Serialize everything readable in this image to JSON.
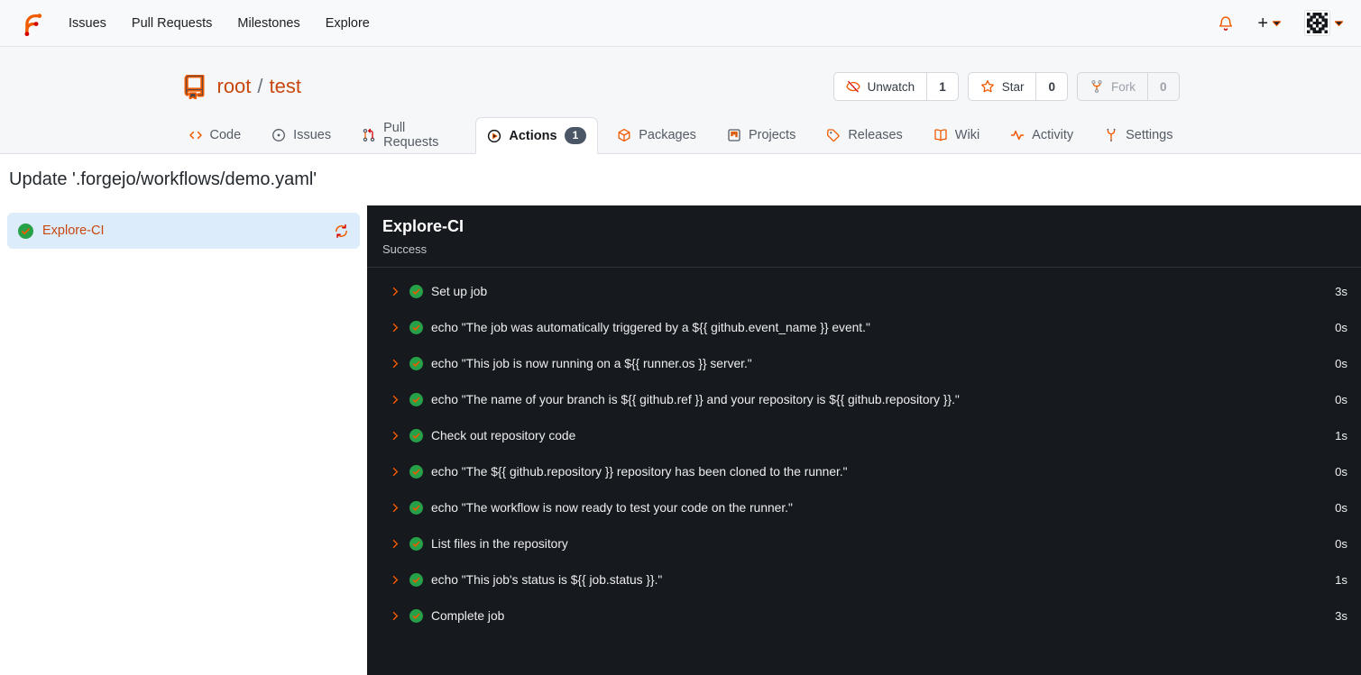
{
  "navbar": {
    "links": [
      {
        "label": "Issues"
      },
      {
        "label": "Pull Requests"
      },
      {
        "label": "Milestones"
      },
      {
        "label": "Explore"
      }
    ],
    "plus_label": "+"
  },
  "repo": {
    "owner": "root",
    "slash": "/",
    "name": "test",
    "buttons": [
      {
        "label": "Unwatch",
        "count": "1",
        "icon": "eye-slash",
        "disabled": false
      },
      {
        "label": "Star",
        "count": "0",
        "icon": "star",
        "disabled": false
      },
      {
        "label": "Fork",
        "count": "0",
        "icon": "fork",
        "disabled": true
      }
    ],
    "tabs": [
      {
        "label": "Code",
        "icon": "code",
        "active": false
      },
      {
        "label": "Issues",
        "icon": "issue-circle",
        "active": false
      },
      {
        "label": "Pull Requests",
        "icon": "git-pull-request",
        "active": false
      },
      {
        "label": "Actions",
        "icon": "play-circle",
        "active": true,
        "badge": "1"
      },
      {
        "label": "Packages",
        "icon": "package-cube",
        "active": false
      },
      {
        "label": "Projects",
        "icon": "project-board",
        "active": false
      },
      {
        "label": "Releases",
        "icon": "tag",
        "active": false
      },
      {
        "label": "Wiki",
        "icon": "book-open",
        "active": false
      },
      {
        "label": "Activity",
        "icon": "pulse",
        "active": false
      }
    ],
    "settings_tab": {
      "label": "Settings"
    }
  },
  "run": {
    "commit_title": "Update '.forgejo/workflows/demo.yaml'",
    "sidebar_job": {
      "name": "Explore-CI"
    },
    "panel": {
      "title": "Explore-CI",
      "status": "Success"
    },
    "steps": [
      {
        "name": "Set up job",
        "duration": "3s"
      },
      {
        "name": "echo \"The job was automatically triggered by a ${{ github.event_name }} event.\"",
        "duration": "0s"
      },
      {
        "name": "echo \"This job is now running on a ${{ runner.os }} server.\"",
        "duration": "0s"
      },
      {
        "name": "echo \"The name of your branch is ${{ github.ref }} and your repository is ${{ github.repository }}.\"",
        "duration": "0s"
      },
      {
        "name": "Check out repository code",
        "duration": "1s"
      },
      {
        "name": "echo \"The ${{ github.repository }} repository has been cloned to the runner.\"",
        "duration": "0s"
      },
      {
        "name": "echo \"The workflow is now ready to test your code on the runner.\"",
        "duration": "0s"
      },
      {
        "name": "List files in the repository",
        "duration": "0s"
      },
      {
        "name": "echo \"This job's status is ${{ job.status }}.\"",
        "duration": "1s"
      },
      {
        "name": "Complete job",
        "duration": "3s"
      }
    ]
  },
  "colors": {
    "brand_orange": "#f05a00",
    "brand_red": "#d40000",
    "link_orange": "#c8470f",
    "success_green": "#26a148",
    "panel_bg": "#16191d",
    "selected_job_bg": "#dcecfb"
  }
}
